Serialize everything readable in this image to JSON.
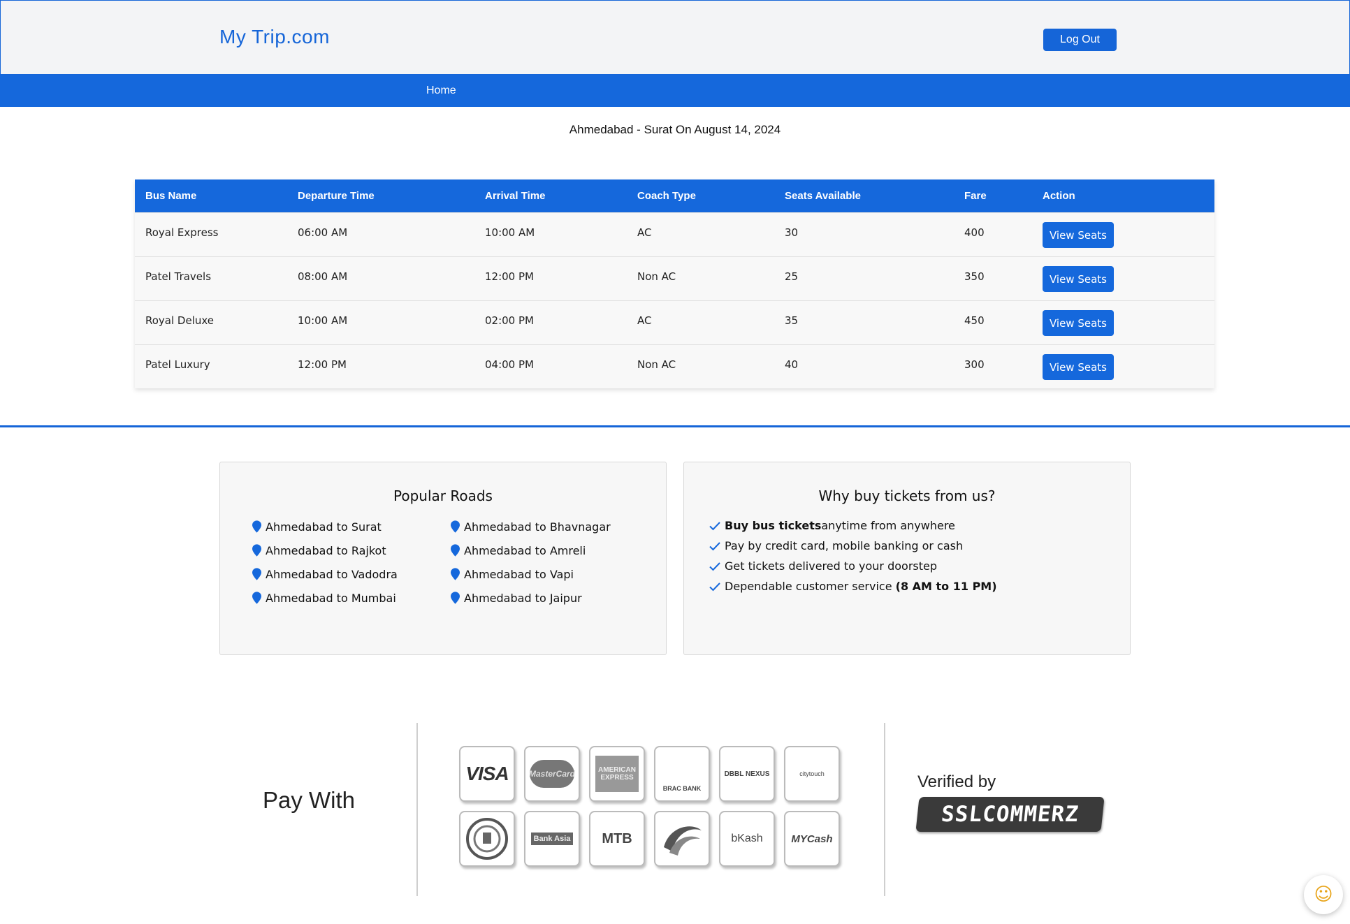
{
  "header": {
    "brand": "My Trip.com",
    "logout_label": "Log Out"
  },
  "nav": {
    "home_label": "Home"
  },
  "route_title": "Ahmedabad - Surat On August 14, 2024",
  "table": {
    "headers": [
      "Bus Name",
      "Departure Time",
      "Arrival Time",
      "Coach Type",
      "Seats Available",
      "Fare",
      "Action"
    ],
    "rows": [
      {
        "bus": "Royal Express",
        "departure": "06:00 AM",
        "arrival": "10:00 AM",
        "coach": "AC",
        "seats": "30",
        "fare": "400",
        "action": "View Seats"
      },
      {
        "bus": "Patel Travels",
        "departure": "08:00 AM",
        "arrival": "12:00 PM",
        "coach": "Non AC",
        "seats": "25",
        "fare": "350",
        "action": "View Seats"
      },
      {
        "bus": "Royal Deluxe",
        "departure": "10:00 AM",
        "arrival": "02:00 PM",
        "coach": "AC",
        "seats": "35",
        "fare": "450",
        "action": "View Seats"
      },
      {
        "bus": "Patel Luxury",
        "departure": "12:00 PM",
        "arrival": "04:00 PM",
        "coach": "Non AC",
        "seats": "40",
        "fare": "300",
        "action": "View Seats"
      }
    ]
  },
  "popular_roads": {
    "title": "Popular Roads",
    "roads": [
      "Ahmedabad to Surat",
      "Ahmedabad to Bhavnagar",
      "Ahmedabad to Rajkot",
      "Ahmedabad to Amreli",
      "Ahmedabad to Vadodra",
      "Ahmedabad to Vapi",
      "Ahmedabad to Mumbai",
      "Ahmedabad to Jaipur"
    ]
  },
  "why_us": {
    "title": "Why buy tickets from us?",
    "items": [
      {
        "bold_pre": "Buy bus tickets",
        "text": " anytime from anywhere",
        "bold_post": ""
      },
      {
        "bold_pre": "",
        "text": "Pay by credit card, mobile banking or cash",
        "bold_post": ""
      },
      {
        "bold_pre": "",
        "text": "Get tickets delivered to your doorstep",
        "bold_post": ""
      },
      {
        "bold_pre": "",
        "text": "Dependable customer service ",
        "bold_post": "(8 AM to 11 PM)"
      }
    ]
  },
  "payment": {
    "pay_with": "Pay With",
    "logos": {
      "visa": "VISA",
      "mastercard": "MasterCard",
      "amex": "AMERICAN EXPRESS",
      "brac": "BRAC BANK",
      "dbbl": "DBBL NEXUS",
      "citytouch": "citytouch",
      "bank_emblem": "",
      "bank_asia": "Bank Asia",
      "mtb": "MTB",
      "rocket": "",
      "bkash": "bKash",
      "mycash": "MYCash"
    },
    "verified_by": "Verified by",
    "verifier": "SSLCOMMERZ"
  },
  "colors": {
    "primary": "#1568dc",
    "header_bg": "#f3f4f6",
    "card_bg": "#f7f7f7"
  }
}
